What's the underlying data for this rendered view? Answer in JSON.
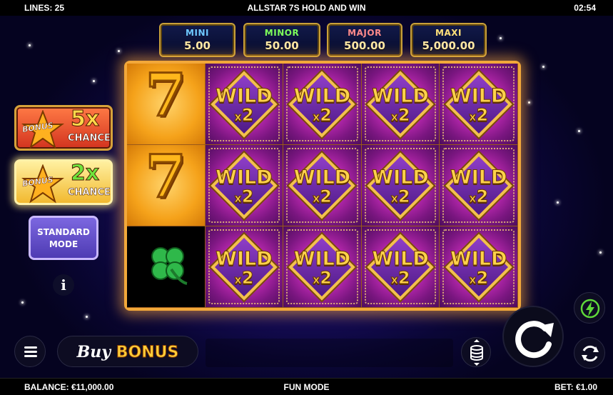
{
  "topbar": {
    "lines": "LINES: 25",
    "title": "ALLSTAR 7S HOLD AND WIN",
    "clock": "02:54"
  },
  "jackpots": [
    {
      "name": "MINI",
      "value": "5.00",
      "color": "#6ec8ff"
    },
    {
      "name": "MINOR",
      "value": "50.00",
      "color": "#7dff5a"
    },
    {
      "name": "MAJOR",
      "value": "500.00",
      "color": "#ff8a8a"
    },
    {
      "name": "MAXI",
      "value": "5,000.00",
      "color": "#ffe07a"
    }
  ],
  "reels": {
    "wild_text": "WILD",
    "multiplier_text": "2",
    "multiplier_prefix": "x",
    "seven_text": "7",
    "grid": [
      [
        "seven",
        "wild",
        "wild",
        "wild",
        "wild"
      ],
      [
        "seven",
        "wild",
        "wild",
        "wild",
        "wild"
      ],
      [
        "clover",
        "wild",
        "wild",
        "wild",
        "wild"
      ]
    ]
  },
  "left_panel": {
    "bonus_5x": {
      "word": "BONUS",
      "mult": "5x",
      "chance": "CHANCE"
    },
    "bonus_2x": {
      "word": "BONUS",
      "mult": "2x",
      "chance": "CHANCE"
    },
    "standard_mode": {
      "line1": "STANDARD",
      "line2": "MODE"
    },
    "info": "i"
  },
  "controls": {
    "buy_label": "Buy",
    "bonus_label": "BONUS"
  },
  "bottombar": {
    "balance": "BALANCE: €11,000.00",
    "mode": "FUN MODE",
    "bet": "BET: €1.00"
  }
}
